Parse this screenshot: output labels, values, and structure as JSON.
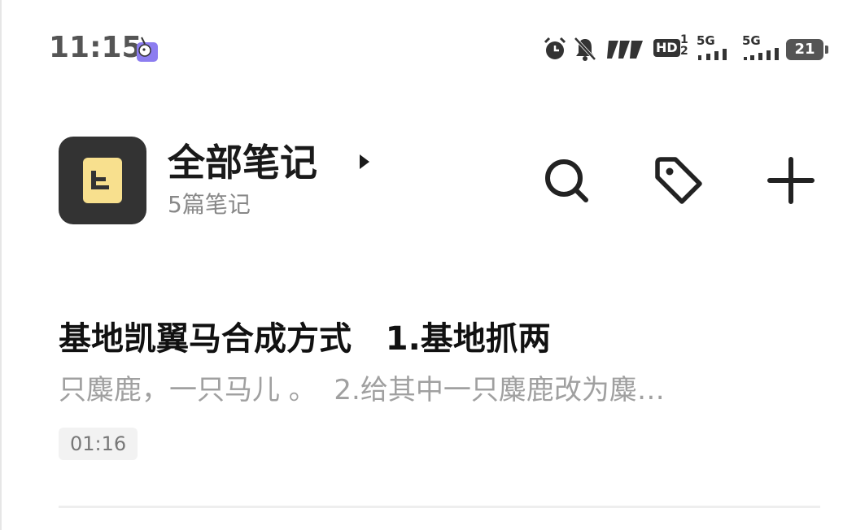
{
  "status_bar": {
    "time": "11:15",
    "hd_label": "HD",
    "hd_sup": "1\n2",
    "net1": "5G",
    "net2": "5G",
    "battery": "21",
    "icons": [
      "alarm-icon",
      "bell-muted-icon",
      "nfc-icon",
      "hd-voice-icon",
      "signal-5g-icon",
      "signal-5g-icon",
      "battery-icon"
    ]
  },
  "header": {
    "title": "全部笔记",
    "count": "5篇笔记"
  },
  "notes": [
    {
      "title": "基地凯翼马合成方式   1.基地抓两",
      "preview": "只麋鹿，一只马儿 。  2.给其中一只麋鹿改为麋…",
      "time": "01:16"
    }
  ],
  "colors": {
    "folder_bg": "#333333",
    "folder_icon": "#f8e08e",
    "accent_text": "#111111",
    "muted_text": "#a0a0a0"
  }
}
